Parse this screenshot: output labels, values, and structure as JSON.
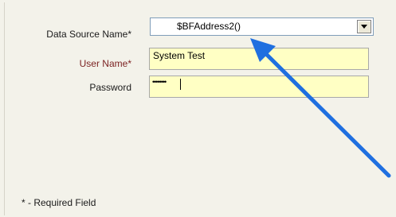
{
  "form": {
    "data_source_label": "Data Source Name*",
    "data_source_value": "$BFAddress2()",
    "user_name_label": "User Name*",
    "user_name_value": "System Test",
    "password_label": "Password",
    "password_value": "••••••••",
    "required_note": "* - Required Field"
  },
  "annotation": {
    "arrow_color": "#1f6fe0"
  },
  "colors": {
    "field_background": "#ffffc4",
    "panel_background": "#f3f2ea",
    "user_label_color": "#7a1f1f"
  },
  "icons": {
    "dropdown": "chevron-down-icon",
    "annotation": "arrow-pointer-icon"
  }
}
